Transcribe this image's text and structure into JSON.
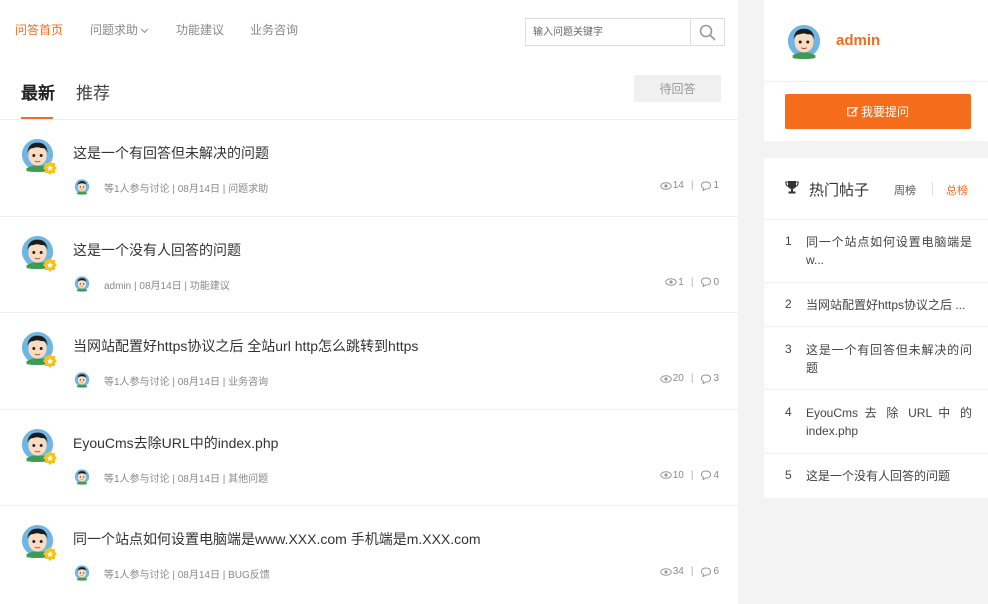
{
  "nav": {
    "items": [
      {
        "label": "问答首页",
        "active": true
      },
      {
        "label": "问题求助",
        "dropdown": true
      },
      {
        "label": "功能建议"
      },
      {
        "label": "业务咨询"
      }
    ]
  },
  "search": {
    "placeholder": "输入问题关键字",
    "icon": "search-icon"
  },
  "tabs": [
    {
      "label": "最新",
      "active": true
    },
    {
      "label": "推荐"
    }
  ],
  "pending_label": "待回答",
  "questions": [
    {
      "title": "这是一个有回答但未解决的问题",
      "meta": "等1人参与讨论 | 08月14日 | 问题求助",
      "views": "14",
      "replies": "1"
    },
    {
      "title": "这是一个没有人回答的问题",
      "meta": "admin | 08月14日 | 功能建议",
      "views": "1",
      "replies": "0"
    },
    {
      "title": "当网站配置好https协议之后 全站url http怎么跳转到https",
      "meta": "等1人参与讨论 | 08月14日 | 业务咨询",
      "views": "20",
      "replies": "3"
    },
    {
      "title": "EyouCms去除URL中的index.php",
      "meta": "等1人参与讨论 | 08月14日 | 其他问题",
      "views": "10",
      "replies": "4"
    },
    {
      "title": "同一个站点如何设置电脑端是www.XXX.com 手机端是m.XXX.com",
      "meta": "等1人参与讨论 | 08月14日 | BUG反馈",
      "views": "34",
      "replies": "6"
    }
  ],
  "user": {
    "name": "admin",
    "ask_label": "我要提问"
  },
  "hot": {
    "title": "热门帖子",
    "week_label": "周榜",
    "total_label": "总榜",
    "items": [
      {
        "num": "1",
        "text": "同一个站点如何设置电脑端是w..."
      },
      {
        "num": "2",
        "text": "当网站配置好https协议之后 ..."
      },
      {
        "num": "3",
        "text": "这是一个有回答但未解决的问题"
      },
      {
        "num": "4",
        "text": "EyouCms 去 除 URL 中 的 index.php"
      },
      {
        "num": "5",
        "text": "这是一个没有人回答的问题"
      }
    ]
  },
  "colors": {
    "accent": "#f56c1a",
    "text": "#333333",
    "muted": "#888888",
    "background": "#f3f3f3"
  }
}
